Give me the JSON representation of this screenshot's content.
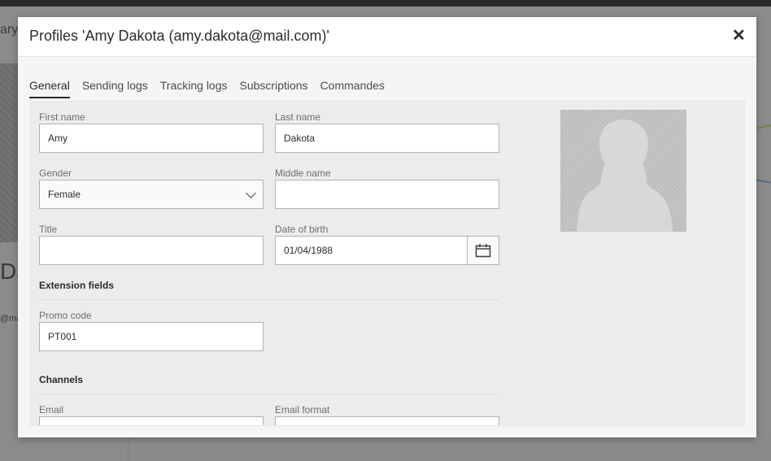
{
  "background": {
    "left_text": "ary",
    "big_text": "Dal",
    "small_text": "@ma"
  },
  "modal": {
    "title": "Profiles 'Amy Dakota (amy.dakota@mail.com)'",
    "close_icon": "close-icon"
  },
  "tabs": [
    {
      "label": "General",
      "active": true
    },
    {
      "label": "Sending logs",
      "active": false
    },
    {
      "label": "Tracking logs",
      "active": false
    },
    {
      "label": "Subscriptions",
      "active": false
    },
    {
      "label": "Commandes",
      "active": false
    }
  ],
  "form": {
    "first_name": {
      "label": "First name",
      "value": "Amy"
    },
    "last_name": {
      "label": "Last name",
      "value": "Dakota"
    },
    "gender": {
      "label": "Gender",
      "value": "Female"
    },
    "middle_name": {
      "label": "Middle name",
      "value": ""
    },
    "title": {
      "label": "Title",
      "value": ""
    },
    "date_of_birth": {
      "label": "Date of birth",
      "value": "01/04/1988"
    },
    "extension_section": "Extension fields",
    "promo_code": {
      "label": "Promo code",
      "value": "PT001"
    },
    "channels_section": "Channels",
    "email": {
      "label": "Email",
      "value": ""
    },
    "email_format": {
      "label": "Email format",
      "value": ""
    }
  },
  "colors": {
    "accent_text": "#2c2c2c",
    "panel_bg": "#ececec",
    "input_border": "#b3b3b3"
  }
}
